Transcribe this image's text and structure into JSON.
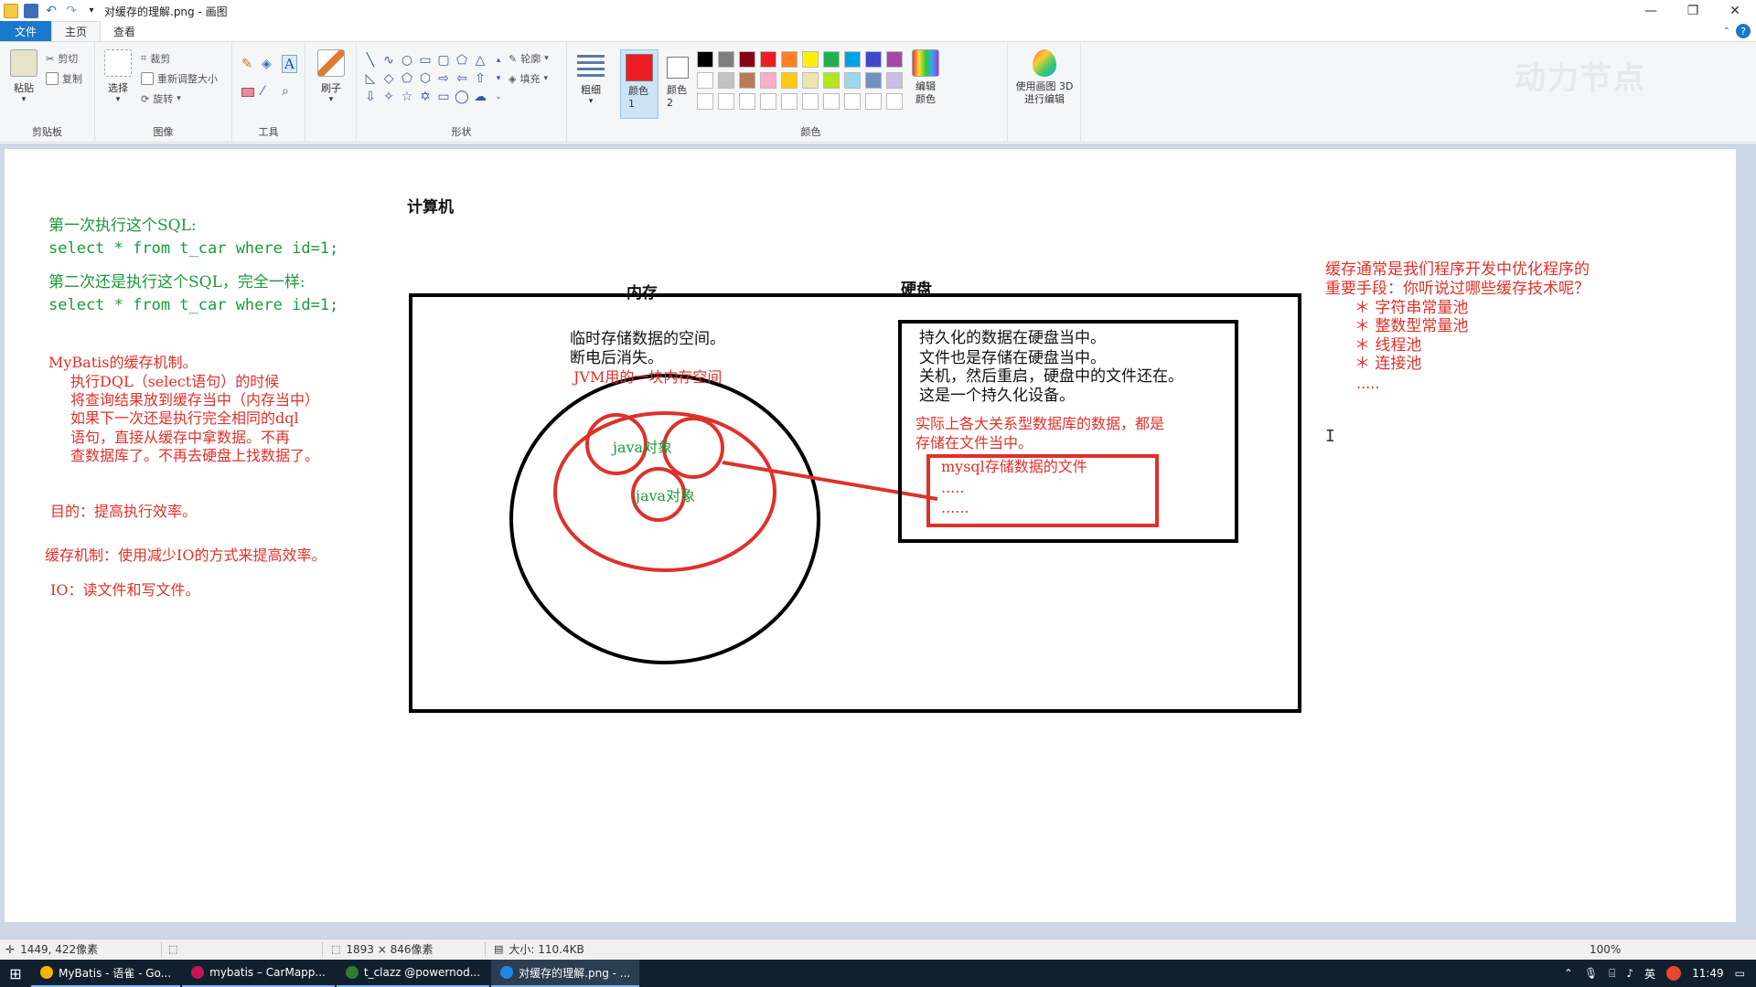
{
  "window": {
    "title": "对缓存的理解.png - 画图",
    "minimize": "—",
    "restore": "❐",
    "close": "✕"
  },
  "ribbon_tabs": [
    {
      "label": "文件"
    },
    {
      "label": "主页"
    },
    {
      "label": "查看"
    }
  ],
  "ribbon": {
    "clipboard": {
      "paste": "粘贴",
      "cut": "剪切",
      "copy": "复制",
      "group": "剪贴板"
    },
    "image": {
      "select": "选择",
      "crop": "裁剪",
      "resize": "重新调整大小",
      "rotate": "旋转",
      "group": "图像"
    },
    "tools": {
      "group": "工具"
    },
    "brush": {
      "label": "刷子"
    },
    "shapes": {
      "outline": "轮廓",
      "fill": "填充",
      "group": "形状"
    },
    "size": {
      "label": "粗细"
    },
    "colors": {
      "color1": "颜色 1",
      "color2": "颜色 2",
      "edit": "编辑颜色",
      "group": "颜色",
      "color1_value": "#ed1c24",
      "color2_value": "#ffffff",
      "palette_row1": [
        "#000000",
        "#7f7f7f",
        "#880015",
        "#ed1c24",
        "#ff7f27",
        "#fff200",
        "#22b14c",
        "#00a2e8",
        "#3f48cc",
        "#a349a4"
      ],
      "palette_row2": [
        "#ffffff",
        "#c3c3c3",
        "#b97a57",
        "#ffaec9",
        "#ffc90e",
        "#efe4b0",
        "#b5e61d",
        "#99d9ea",
        "#7092be",
        "#c8bfe7"
      ]
    },
    "paint3d": "使用画图 3D 进行编辑",
    "watermark": "动力节点"
  },
  "canvas": {
    "left_notes": {
      "line1": "第一次执行这个SQL:",
      "line2": "select * from t_car where id=1;",
      "line3": "第二次还是执行这个SQL，完全一样:",
      "line4": "select * from t_car where id=1;",
      "mybatis_title": "MyBatis的缓存机制。",
      "mybatis_1": "执行DQL（select语句）的时候",
      "mybatis_2": "将查询结果放到缓存当中（内存当中）",
      "mybatis_3": "如果下一次还是执行完全相同的dql",
      "mybatis_4": "语句，直接从缓存中拿数据。不再",
      "mybatis_5": "查数据库了。不再去硬盘上找数据了。",
      "purpose": "目的：提高执行效率。",
      "cache_mech": "缓存机制：使用减少IO的方式来提高效率。",
      "io": "IO：读文件和写文件。"
    },
    "computer_label": "计算机",
    "memory_label": "内存",
    "disk_label": "硬盘",
    "memory_text": {
      "l1": "临时存储数据的空间。",
      "l2": "断电后消失。",
      "l3": "JVM用的一块内存空间",
      "obj1": "java对象",
      "obj2": "java对象"
    },
    "disk_text": {
      "l1": "持久化的数据在硬盘当中。",
      "l2": "文件也是存储在硬盘当中。",
      "l3": "关机，然后重启，硬盘中的文件还在。",
      "l4": "这是一个持久化设备。",
      "r1": "实际上各大关系型数据库的数据，都是",
      "r2": "存储在文件当中。",
      "file1": "mysql存储数据的文件",
      "file2": ".....",
      "file3": "......"
    },
    "right_notes": {
      "l1": "缓存通常是我们程序开发中优化程序的",
      "l2": "重要手段：你听说过哪些缓存技术呢？",
      "b1": "＊ 字符串常量池",
      "b2": "＊ 整数型常量池",
      "b3": "＊ 线程池",
      "b4": "＊ 连接池",
      "b5": "....."
    }
  },
  "statusbar": {
    "cursor_pos": "1449, 422像素",
    "image_size": "1893 × 846像素",
    "file_size": "大小: 110.4KB",
    "zoom": "100%"
  },
  "taskbar": {
    "items": [
      {
        "label": "MyBatis - 语雀 - Go...",
        "color": "#f4b400"
      },
      {
        "label": "mybatis – CarMapp...",
        "color": "#c2185b"
      },
      {
        "label": "t_clazz @powernod...",
        "color": "#2e7d32"
      },
      {
        "label": "对缓存的理解.png - ...",
        "color": "#1e88e5"
      }
    ],
    "ime": "英",
    "clock": "11:49",
    "lang": "英"
  }
}
